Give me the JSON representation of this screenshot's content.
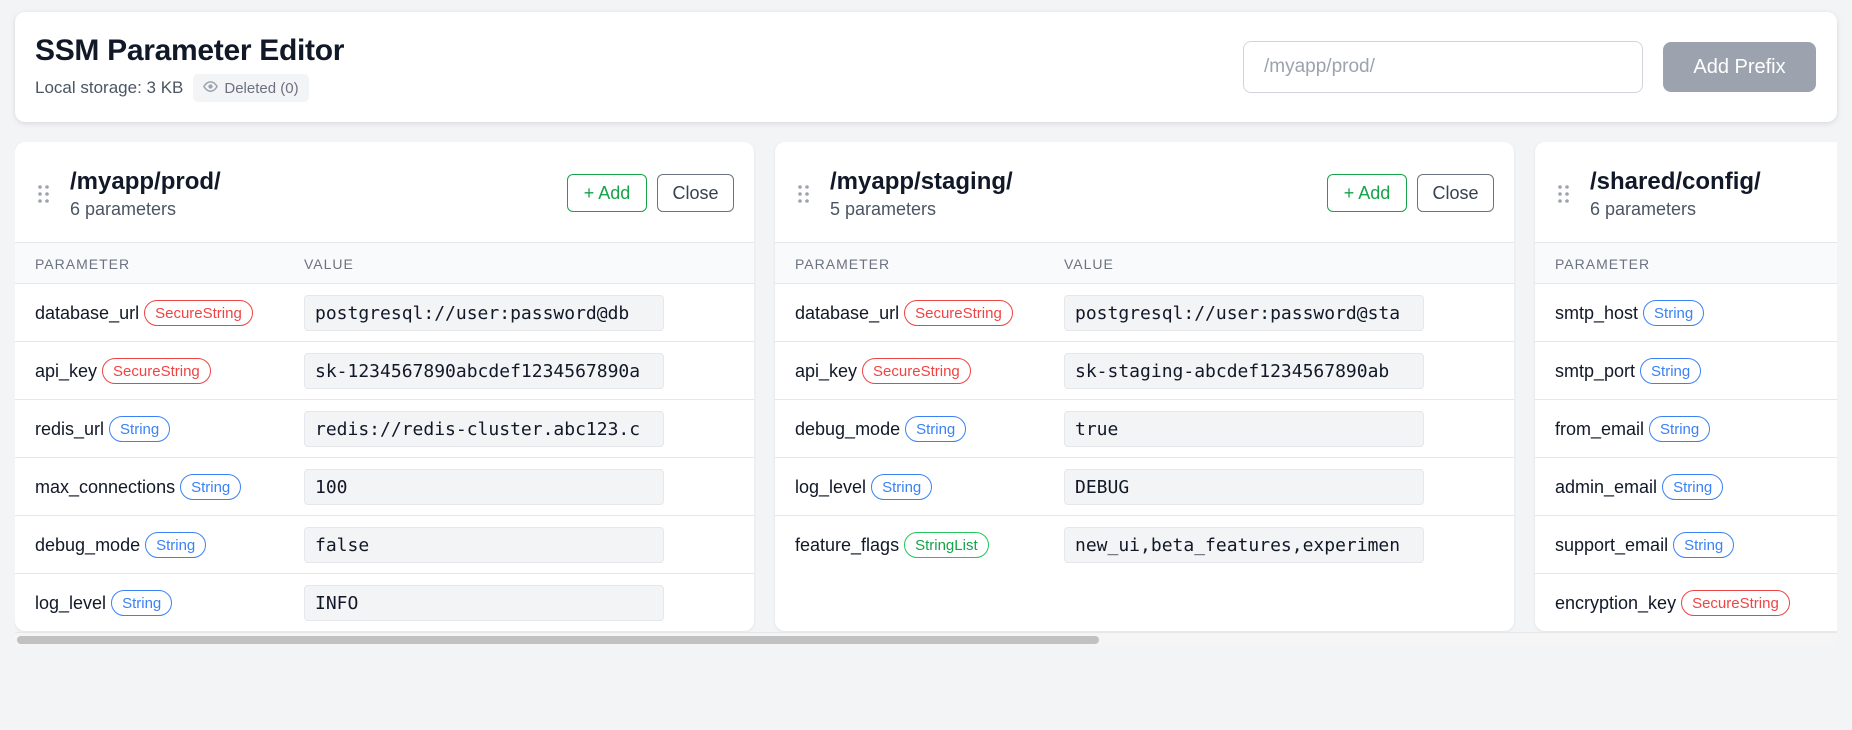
{
  "header": {
    "title": "SSM Parameter Editor",
    "storage": "Local storage: 3 KB",
    "deleted_label": "Deleted (0)",
    "prefix_placeholder": "/myapp/prod/",
    "add_prefix_label": "Add Prefix"
  },
  "columns": {
    "parameter": "PARAMETER",
    "value": "VALUE"
  },
  "actions": {
    "add": "+ Add",
    "close": "Close"
  },
  "panels": [
    {
      "title": "/myapp/prod/",
      "count": "6 parameters",
      "params": [
        {
          "name": "database_url",
          "type": "SecureString",
          "value": "postgresql://user:password@db"
        },
        {
          "name": "api_key",
          "type": "SecureString",
          "value": "sk-1234567890abcdef1234567890a"
        },
        {
          "name": "redis_url",
          "type": "String",
          "value": "redis://redis-cluster.abc123.c"
        },
        {
          "name": "max_connections",
          "type": "String",
          "value": "100"
        },
        {
          "name": "debug_mode",
          "type": "String",
          "value": "false"
        },
        {
          "name": "log_level",
          "type": "String",
          "value": "INFO"
        }
      ]
    },
    {
      "title": "/myapp/staging/",
      "count": "5 parameters",
      "params": [
        {
          "name": "database_url",
          "type": "SecureString",
          "value": "postgresql://user:password@sta"
        },
        {
          "name": "api_key",
          "type": "SecureString",
          "value": "sk-staging-abcdef1234567890ab"
        },
        {
          "name": "debug_mode",
          "type": "String",
          "value": "true"
        },
        {
          "name": "log_level",
          "type": "String",
          "value": "DEBUG"
        },
        {
          "name": "feature_flags",
          "type": "StringList",
          "value": "new_ui,beta_features,experimen"
        }
      ]
    },
    {
      "title": "/shared/config/",
      "count": "6 parameters",
      "params": [
        {
          "name": "smtp_host",
          "type": "String",
          "value": ""
        },
        {
          "name": "smtp_port",
          "type": "String",
          "value": ""
        },
        {
          "name": "from_email",
          "type": "String",
          "value": ""
        },
        {
          "name": "admin_email",
          "type": "String",
          "value": ""
        },
        {
          "name": "support_email",
          "type": "String",
          "value": ""
        },
        {
          "name": "encryption_key",
          "type": "SecureString",
          "value": ""
        }
      ]
    }
  ],
  "colors": {
    "secure": "#ef4444",
    "string": "#3b82f6",
    "string_list": "#22c55e",
    "add_green": "#16a34a",
    "disabled_button": "#9ca3af"
  },
  "icons": {
    "deleted": "eye-icon",
    "panel_handle": "drag-handle-icon"
  }
}
